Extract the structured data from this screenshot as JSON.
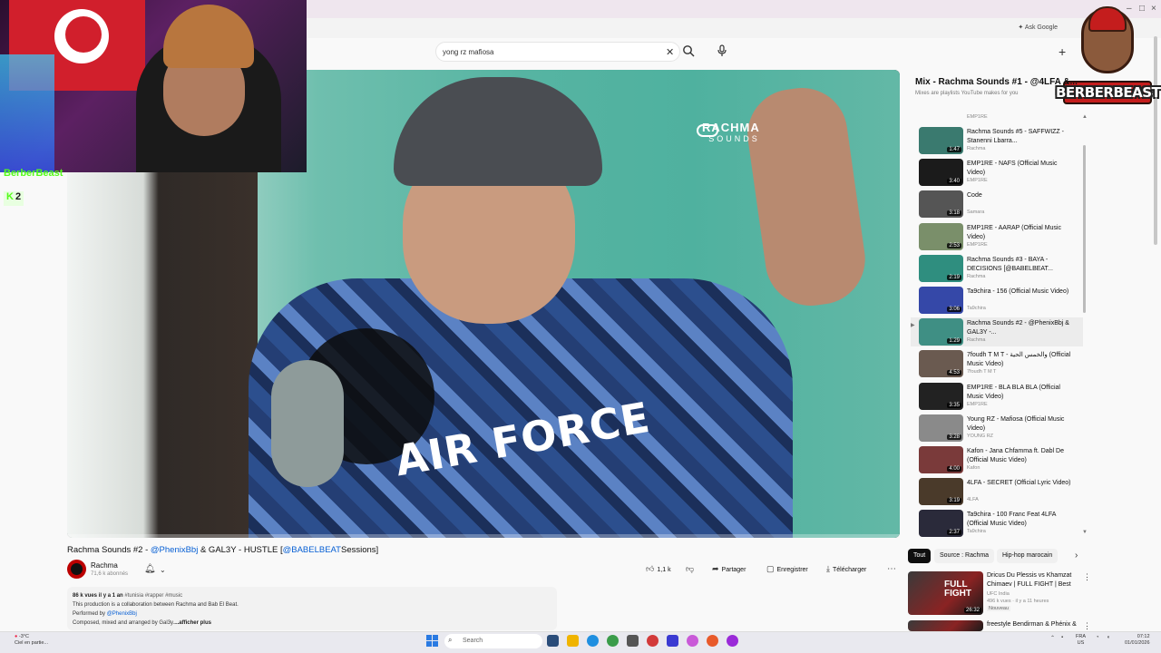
{
  "browser": {
    "ask_google": "Ask Google",
    "new_tab": "+",
    "window_controls": [
      "–",
      "□",
      "×"
    ]
  },
  "search": {
    "query": "yong rz mafiosa",
    "clear_icon": "close-icon",
    "search_icon": "search-icon",
    "mic_icon": "mic-icon"
  },
  "video": {
    "watermark_brand": "RACHMA",
    "watermark_sub": "SOUNDS",
    "jersey_text": "AIR FORCE",
    "title_prefix": "Rachma Sounds #2 - ",
    "title_mention1": "@PhenixBbj",
    "title_mid": " & GAL3Y - HUSTLE [",
    "title_mention2": "@BABELBEAT",
    "title_suffix": "Sessions]",
    "progress": 0.0
  },
  "overlay": {
    "streamer_tag": "BerberBeast",
    "viewer_count": "2",
    "logo_text": "BERBERBEAST"
  },
  "channel": {
    "name": "Rachma",
    "subscribers": "71,6 k abonnés"
  },
  "actions": {
    "likes": "1,1 k",
    "share": "Partager",
    "save": "Enregistrer",
    "download": "Télécharger"
  },
  "description": {
    "meta": "86 k vues  il y a 1 an",
    "tags": "#tunisia #rapper #music",
    "line1": "This production is a collaboration between Rachma and Bab El Beat.",
    "performed_by_label": "Performed by ",
    "performed_by": "@PhenixBbj",
    "line3": "Composed, mixed and arranged by Gal3y.",
    "show_more": "...afficher plus"
  },
  "playlist": {
    "title": "Mix - Rachma Sounds #1 - @4LFA &...",
    "subtitle": "Mixes are playlists YouTube makes for you",
    "top_partial_channel": "EMP1RE",
    "items": [
      {
        "title": "Rachma Sounds #5 - SAFFWIZZ - Stanenni Lbarra...",
        "channel": "Rachma",
        "duration": "1:47",
        "color": "#3a7a6f"
      },
      {
        "title": "EMP1RE - NAFS (Official Music Video)",
        "channel": "EMP1RE",
        "duration": "3:40",
        "color": "#1b1b1b"
      },
      {
        "title": "Code",
        "channel": "Samara",
        "duration": "3:18",
        "color": "#555555"
      },
      {
        "title": "EMP1RE - AARAP (Official Music Video)",
        "channel": "EMP1RE",
        "duration": "2:53",
        "color": "#7a8f6a"
      },
      {
        "title": "Rachma Sounds #3 - BAYA - DECISIONS [@BABELBEAT...",
        "channel": "Rachma",
        "duration": "2:19",
        "color": "#2f8e7f"
      },
      {
        "title": "Ta9chira - 156 (Official Music Video)",
        "channel": "Ta9chira",
        "duration": "3:06",
        "color": "#3548a8"
      },
      {
        "title": "Rachma Sounds #2 - @PhenixBbj & GAL3Y -...",
        "channel": "Rachma",
        "duration": "1:29",
        "color": "#3f8f84"
      },
      {
        "title": "7foudh T M T - والخمس الحية (Official Music Video)",
        "channel": "7foudh T M T",
        "duration": "4:53",
        "color": "#6a5a50"
      },
      {
        "title": "EMP1RE - BLA BLA BLA (Official Music Video)",
        "channel": "EMP1RE",
        "duration": "3:35",
        "color": "#222222"
      },
      {
        "title": "Young RZ - Mafiosa (Official Music Video)",
        "channel": "YOUNG RZ",
        "duration": "3:28",
        "color": "#8a8a8a"
      },
      {
        "title": "Kafon - Jana Chfamma ft. Dabl De (Official Music Video)",
        "channel": "Kafon",
        "duration": "4:00",
        "color": "#7a3a3a"
      },
      {
        "title": "4LFA - SECRET (Official Lyric Video)",
        "channel": "4LFA",
        "duration": "3:19",
        "color": "#4a3a2a"
      },
      {
        "title": "Ta9chira - 100 Franc Feat 4LFA (Official Music Video)",
        "channel": "Ta9chira",
        "duration": "2:37",
        "color": "#2a2a3a"
      }
    ]
  },
  "chips": {
    "all": "Tout",
    "source": "Source : Rachma",
    "hiphop": "Hip-hop marocain"
  },
  "recommended": [
    {
      "title": "Dricus Du Plessis vs Khamzat Chimaev | FULL FIGHT | Best D...",
      "channel": "UFC India",
      "meta": "496 k vues · il y a 11 heures",
      "badge": "Nouveau",
      "thumb_text": "FULL FIGHT",
      "duration": "26:32"
    },
    {
      "title": "freestyle Bendirman & Phénix &",
      "channel": "",
      "meta": "",
      "badge": "",
      "thumb_text": "",
      "duration": ""
    }
  ],
  "taskbar": {
    "weather_temp": "-3°C",
    "weather_desc": "Ciel en partie...",
    "search_placeholder": "Search",
    "lang_top": "FRA",
    "lang_bottom": "US",
    "time": "07:12",
    "date": "01/01/2026"
  }
}
